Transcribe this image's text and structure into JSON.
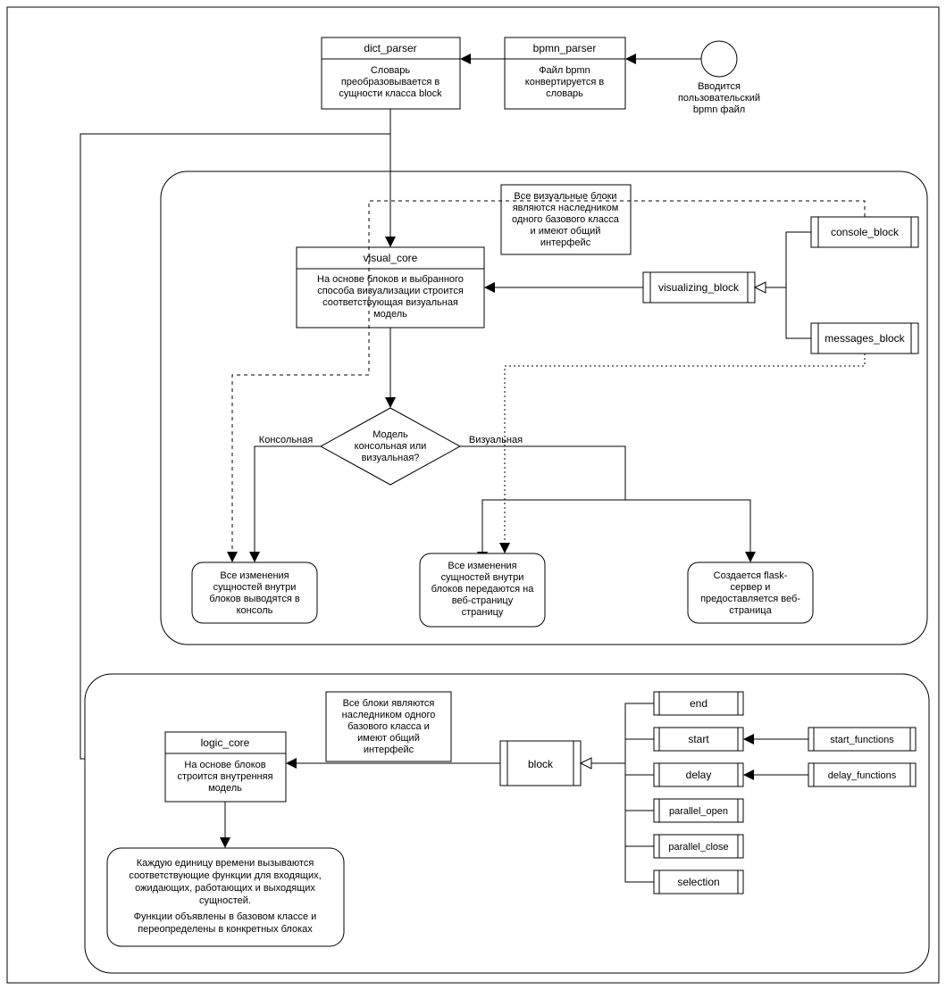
{
  "start": {
    "caption1": "Вводится",
    "caption2": "пользовательский",
    "caption3": "bpmn файл"
  },
  "bpmn_parser": {
    "title": "bpmn_parser",
    "desc1": "Файл bpmn",
    "desc2": "конвертируется в",
    "desc3": "словарь"
  },
  "dict_parser": {
    "title": "dict_parser",
    "desc1": "Словарь",
    "desc2": "преобразовывается в",
    "desc3": "сущности класса block"
  },
  "visual_core": {
    "title": "visual_core",
    "desc1": "На основе блоков и выбранного",
    "desc2": "способа визуализации строится",
    "desc3": "соответствующая визуальная",
    "desc4": "модель"
  },
  "visual_note": {
    "l1": "Все визуальные блоки",
    "l2": "являются наследником",
    "l3": "одного базового класса",
    "l4": "и имеют общий",
    "l5": "интерфейс"
  },
  "visualizing_block": {
    "label": "visualizing_block"
  },
  "console_block": {
    "label": "console_block"
  },
  "messages_block": {
    "label": "messages_block"
  },
  "decision": {
    "l1": "Модель",
    "l2": "консольная или",
    "l3": "визуальная?",
    "left": "Консольная",
    "right": "Визуальная"
  },
  "out_console": {
    "l1": "Все изменения",
    "l2": "сущностей внутри",
    "l3": "блоков выводятся в",
    "l4": "консоль"
  },
  "out_web": {
    "l1": "Все изменения",
    "l2": "сущностей внутри",
    "l3": "блоков передаются на",
    "l4": "веб-страницу",
    "l5": "страницу"
  },
  "out_flask": {
    "l1": "Создается flask-",
    "l2": "сервер и",
    "l3": "предоставляется веб-",
    "l4": "страница"
  },
  "logic_core": {
    "title": "logic_core",
    "desc1": "На основе блоков",
    "desc2": "строится внутренняя",
    "desc3": "модель"
  },
  "logic_note": {
    "l1": "Все блоки являются",
    "l2": "наследником одного",
    "l3": "базового класса и",
    "l4": "имеют общий",
    "l5": "интерфейс"
  },
  "block": {
    "label": "block"
  },
  "blocks": {
    "end": "end",
    "start": "start",
    "delay": "delay",
    "parallel_open": "parallel_open",
    "parallel_close": "parallel_close",
    "selection": "selection"
  },
  "start_functions": {
    "label": "start_functions"
  },
  "delay_functions": {
    "label": "delay_functions"
  },
  "logic_result": {
    "l1": "Каждую единицу времени вызываются",
    "l2": "соответствующие функции для входящих,",
    "l3": "ожидающих, работающих и выходящих",
    "l4": "сущностей.",
    "l5": "Функции объявлены в базовом классе и",
    "l6": "переопределены в конкретных блоках"
  }
}
